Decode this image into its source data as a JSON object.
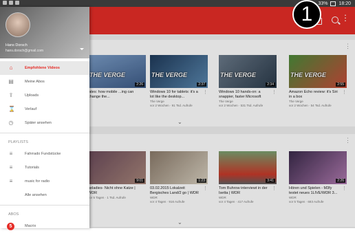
{
  "status": {
    "battery": "33%",
    "time": "18:20"
  },
  "callout": "1",
  "drawer": {
    "account": {
      "name": "Hans Dorsch",
      "email": "hans.dorsch@gmail.com"
    },
    "items": [
      {
        "label": "Empfohlene Videos",
        "icon": "home-icon",
        "active": true
      },
      {
        "label": "Meine Abos",
        "icon": "subscriptions-icon"
      },
      {
        "label": "Uploads",
        "icon": "upload-icon"
      },
      {
        "label": "Verlauf",
        "icon": "history-icon"
      },
      {
        "label": "Später ansehen",
        "icon": "clock-icon"
      }
    ],
    "playlists_heading": "PLAYLISTS",
    "playlists": [
      {
        "label": "Fahrrado Fundstücke"
      },
      {
        "label": "Tutorials"
      },
      {
        "label": "music for radio"
      },
      {
        "label": "Alle ansehen"
      }
    ],
    "abos_heading": "ABOS",
    "abos": [
      {
        "label": "Macrix",
        "badge": "5"
      }
    ]
  },
  "row1": [
    {
      "title": "iates: how mobile ...ing can change the...",
      "channel": "",
      "meta": "",
      "duration": "2:26",
      "verge": "THE VERGE"
    },
    {
      "title": "Windows 10 for tablets: it's a lot like the desktop...",
      "channel": "The Verge",
      "meta": "vor 2 Wochen · 91 Tsd. Aufrufe",
      "duration": "2:37",
      "verge": "THE VERGE"
    },
    {
      "title": "Windows 10 hands-on: a snappier, faster Microsoft",
      "channel": "The Verge",
      "meta": "vor 2 Wochen · 531 Tsd. Aufrufe",
      "duration": "2:34",
      "verge": "THE VERGE"
    },
    {
      "title": "Amazon Echo review: it's Siri in a box",
      "channel": "The Verge",
      "meta": "vor 2 Wochen · 54 Tsd. Aufrufe",
      "duration": "2:55",
      "verge": "THE VERGE"
    }
  ],
  "row2": [
    {
      "title": "ueladies- Nicht ohne Katze | WDR",
      "channel": "",
      "meta": "vor 5 Tagen · 1 Tsd. Aufrufe",
      "duration": "9:01"
    },
    {
      "title": "03.02.2015 Lokalzeit Bergisches Land/2 go | WDR",
      "channel": "WDR",
      "meta": "vor 4 Tagen · 916 Aufrufe",
      "duration": "1:23"
    },
    {
      "title": "Tom Buhrow interviewt in der Isetta | WDR",
      "channel": "WDR",
      "meta": "vor 4 Tagen · 417 Aufrufe",
      "duration": "3:41"
    },
    {
      "title": "Hören und Spielen - M3fy testet neues 1LIVE/WDR 3...",
      "channel": "WDR",
      "meta": "vor 5 Tagen · 683 Aufrufe",
      "duration": "2:26"
    }
  ]
}
